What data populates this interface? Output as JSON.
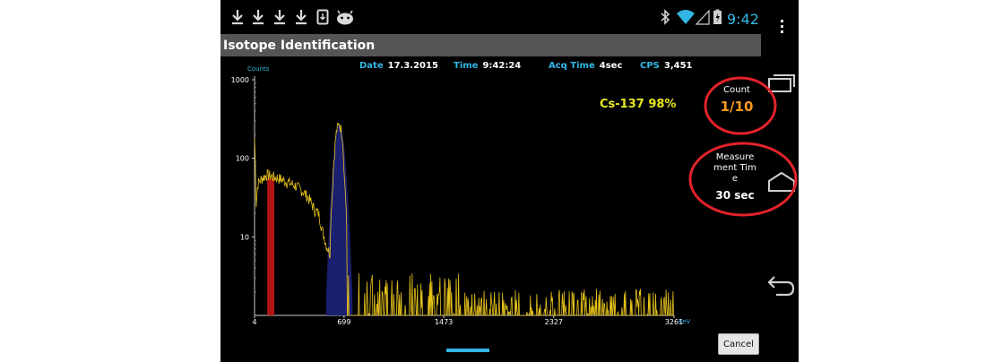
{
  "status_bar": {
    "time": "9:42",
    "notification_icons": [
      "download-icon",
      "download-icon",
      "download-icon",
      "download-icon",
      "sd-card-icon",
      "android-robot-icon"
    ],
    "system_icons": [
      "bluetooth-icon",
      "wifi-icon",
      "signal-icon",
      "battery-icon"
    ]
  },
  "title_bar": {
    "title": "Isotope Identification"
  },
  "info": {
    "date_label": "Date",
    "date": "17.3.2015",
    "time_label": "Time",
    "time": "9:42:24",
    "acq_label": "Acq Time",
    "acq": "4sec",
    "cps_label": "CPS",
    "cps": "3,451"
  },
  "chart_data": {
    "type": "line",
    "ylabel": "Counts",
    "xlabel": "KeV",
    "yscale": "log",
    "ylim": [
      1,
      1000
    ],
    "xlim": [
      4,
      3261
    ],
    "y_ticks": [
      "1000",
      "100",
      "10"
    ],
    "x_ticks": [
      "4",
      "699",
      "1473",
      "2327",
      "3261"
    ],
    "series_color": "#e6c21a",
    "peak_color": "#1a1f6e",
    "marker_color": "#b01515",
    "marker_energy": 130,
    "peak_energy": 662,
    "peak_counts": 280,
    "spectrum": {
      "x": [
        4,
        15,
        30,
        60,
        100,
        150,
        200,
        260,
        320,
        380,
        430,
        470,
        500,
        530,
        560,
        590,
        610,
        625,
        640,
        662,
        685,
        700,
        720,
        740,
        760,
        800,
        900,
        1000,
        1100,
        1200,
        1300,
        1400,
        1500,
        1600,
        1700,
        1800,
        1900,
        2000,
        2200,
        2400,
        2600,
        2800,
        3000,
        3200,
        3261
      ],
      "y": [
        180,
        22,
        48,
        55,
        62,
        58,
        55,
        50,
        45,
        38,
        30,
        22,
        20,
        12,
        8,
        6,
        40,
        120,
        220,
        280,
        200,
        60,
        10,
        3,
        2.5,
        2.2,
        2.5,
        2.2,
        2.0,
        2.2,
        2.1,
        1.8,
        1.6,
        1.5,
        1.5,
        1.5,
        1.4,
        1.4,
        1.3,
        1.3,
        1.3,
        1.3,
        1.2,
        1.2,
        1.2
      ]
    }
  },
  "identification": {
    "result": "Cs-137  98%"
  },
  "count_panel": {
    "label": "Count",
    "value": "1/10"
  },
  "measurement_panel": {
    "label": "Measurement Time",
    "value": "30 sec"
  },
  "buttons": {
    "cancel": "Cancel"
  },
  "colors": {
    "accent": "#33b5e5",
    "annotation": "#e2222a",
    "count_value": "#ff9a1a",
    "title_bg": "#555555"
  }
}
